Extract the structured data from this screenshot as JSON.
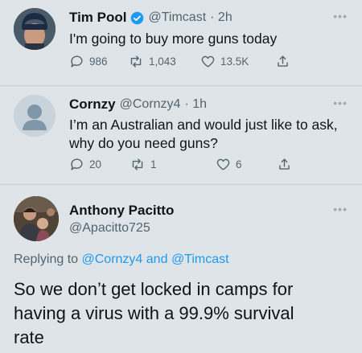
{
  "tweet1": {
    "name": "Tim Pool",
    "handle": "@Timcast",
    "time": "· 2h",
    "text": "I'm going to buy more guns today",
    "replies": "986",
    "retweets": "1,043",
    "likes": "13.5K",
    "verified": true,
    "avatar": "profile-photo-beanie"
  },
  "tweet2": {
    "name": "Cornzy",
    "handle": "@Cornzy4",
    "time": "· 1h",
    "text1": "I’m an Australian and would just like to ask,",
    "text2": "why do you need guns?",
    "replies": "20",
    "retweets": "1",
    "likes": "6",
    "avatar": "default-avatar"
  },
  "tweet3": {
    "name": "Anthony Pacitto",
    "handle": "@Apacitto725",
    "replying_prefix": "Replying to",
    "replying_user1": "@Cornzy4",
    "replying_and": "and",
    "replying_user2": "@Timcast",
    "text1": "So we don’t get locked in camps for",
    "text2": "having a virus with a 99.9% survival",
    "text3": "rate",
    "avatar": "profile-photo-family"
  },
  "colors": {
    "accent": "#1d9bf0",
    "secondary_text": "#536471",
    "background": "#dfe4e8"
  }
}
